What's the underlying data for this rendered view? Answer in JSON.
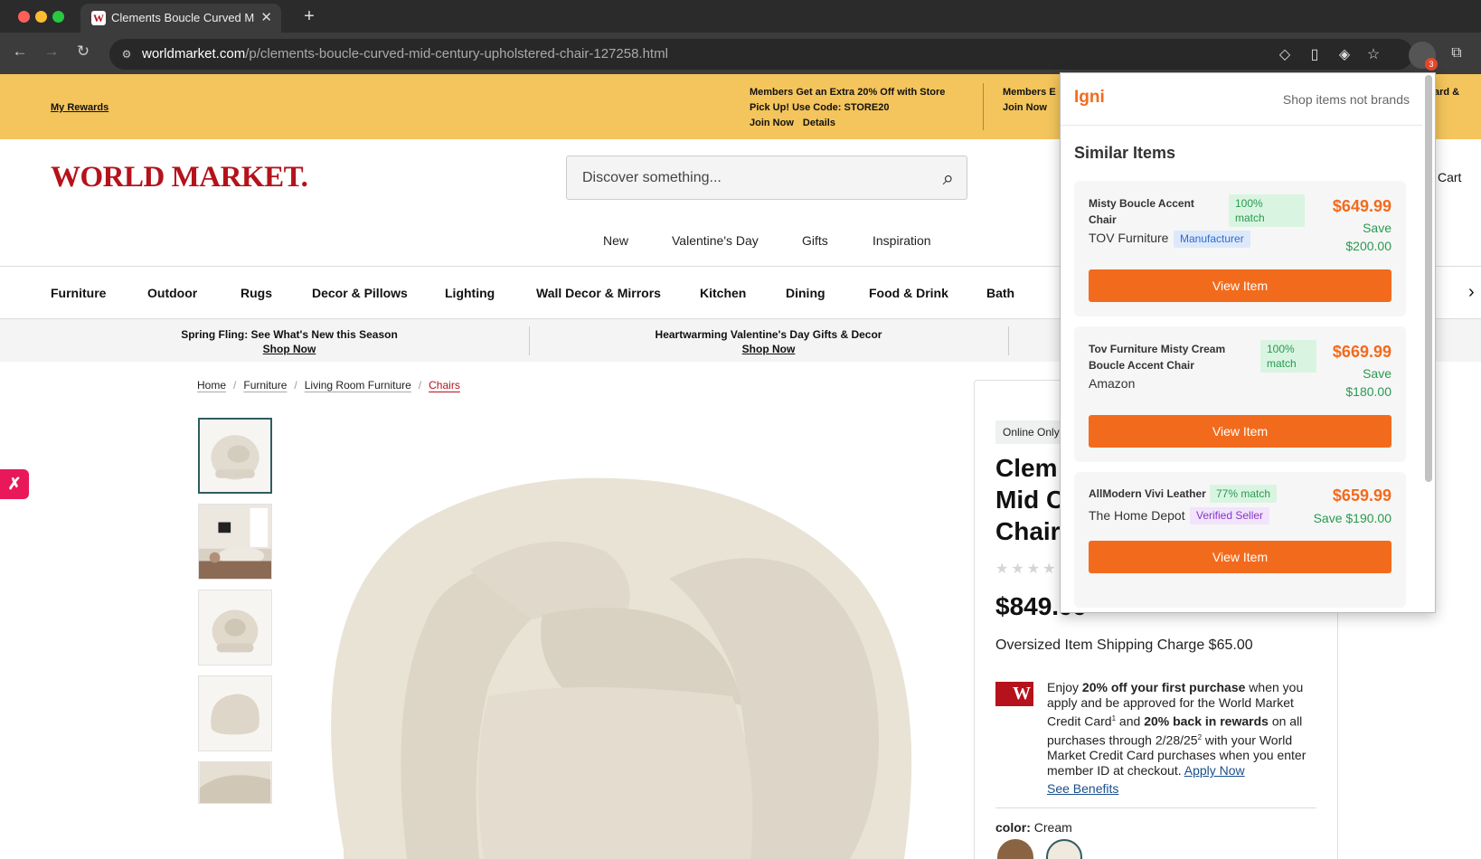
{
  "browser": {
    "tab_title": "Clements Boucle Curved Mid",
    "url_domain": "worldmarket.com",
    "url_path": "/p/clements-boucle-curved-mid-century-upholstered-chair-127258.html",
    "extension_badge": "3"
  },
  "promo": {
    "rewards": "My Rewards",
    "offer_1_line1": "Members Get an Extra 20% Off with Store",
    "offer_1_line2": "Pick Up! Use Code: STORE20",
    "offer_1_join": "Join Now",
    "offer_1_details": "Details",
    "offer_2_line1": "Members E",
    "offer_2_join": "Join Now",
    "offer_3_fragment": "ard &"
  },
  "header": {
    "logo": "WORLD MARKET.",
    "search_placeholder": "Discover something...",
    "cart": "Cart"
  },
  "top_nav": [
    "New",
    "Valentine's Day",
    "Gifts",
    "Inspiration"
  ],
  "categories": [
    "Furniture",
    "Outdoor",
    "Rugs",
    "Decor & Pillows",
    "Lighting",
    "Wall Decor & Mirrors",
    "Kitchen",
    "Dining",
    "Food & Drink",
    "Bath"
  ],
  "banners": [
    {
      "title": "Spring Fling: See What's New this Season",
      "link": "Shop Now"
    },
    {
      "title": "Heartwarming Valentine's Day Gifts & Decor",
      "link": "Shop Now"
    }
  ],
  "breadcrumb": [
    "Home",
    "Furniture",
    "Living Room Furniture",
    "Chairs"
  ],
  "product": {
    "badge": "Online Only",
    "title_line1": "Clem",
    "title_line2": "Mid C",
    "title_line3": "Chair",
    "stars": "★★★★",
    "price": "$849.99",
    "shipping": "Oversized Item Shipping Charge $65.00",
    "cc_logo": "W",
    "cc_t1": "Enjoy ",
    "cc_b1": "20% off your first purchase",
    "cc_t2": " when you apply and be approved for the World Market Credit Card",
    "cc_sup1": "1",
    "cc_t3": " and ",
    "cc_b2": "20% back in rewards",
    "cc_t4": " on all purchases through 2/28/25",
    "cc_sup2": "2",
    "cc_t5": " with your World Market Credit Card purchases when you enter member ID at checkout. ",
    "cc_apply": "Apply Now",
    "cc_benefits": "See Benefits",
    "color_label": "color:",
    "color_value": "Cream"
  },
  "igni": {
    "brand": "Igni",
    "tagline": "Shop items not brands",
    "section": "Similar Items",
    "items": [
      {
        "name_1": "Misty Boucle Accent",
        "name_2": "Chair",
        "match_1": "100%",
        "match_2": "match",
        "price": "$649.99",
        "save_1": "Save",
        "save_2": "$200.00",
        "seller": "TOV Furniture",
        "seller_badge": "Manufacturer",
        "button": "View Item"
      },
      {
        "name_1": "Tov Furniture Misty Cream",
        "name_2": "Boucle Accent Chair",
        "match_1": "100%",
        "match_2": "match",
        "price": "$669.99",
        "save_1": "Save",
        "save_2": "$180.00",
        "seller": "Amazon",
        "button": "View Item"
      },
      {
        "name_1": "AllModern Vivi Leather",
        "match_1": "77% match",
        "price": "$659.99",
        "save_1": "Save $190.00",
        "seller": "The Home Depot",
        "seller_badge": "Verified Seller",
        "button": "View Item"
      }
    ]
  },
  "colors": {
    "brand_red": "#b5121b",
    "promo_yellow": "#f4c55c",
    "igni_orange": "#f26b1d",
    "save_green": "#2a9950"
  }
}
